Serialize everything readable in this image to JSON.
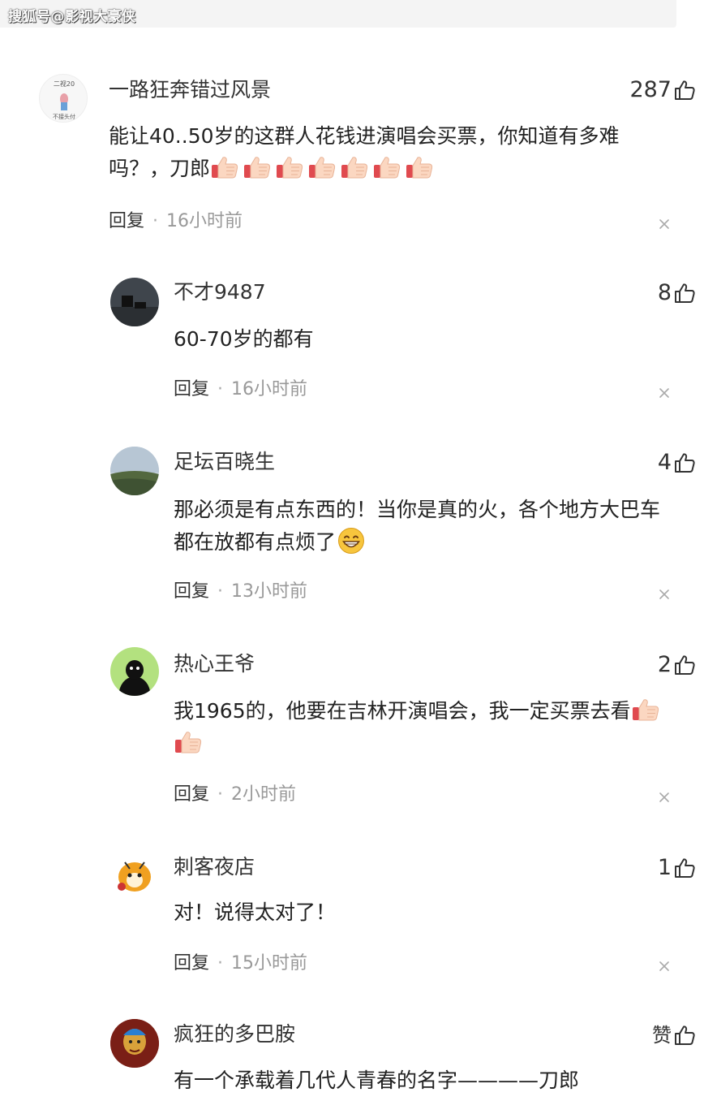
{
  "watermark": "搜狐号@影视大豪侠",
  "comments": [
    {
      "username": "一路狂奔错过风景",
      "likes": "287",
      "text": "能让40..50岁的这群人花钱进演唱会买票，你知道有多难吗？，刀郎",
      "emoji_count": 7,
      "reply_label": "回复",
      "separator": "·",
      "time": "16小时前",
      "avatar": {
        "text_top": "二视20",
        "text_bottom": "不接头付"
      }
    },
    {
      "username": "不才9487",
      "likes": "8",
      "text": "60-70岁的都有",
      "reply_label": "回复",
      "separator": "·",
      "time": "16小时前"
    },
    {
      "username": "足坛百晓生",
      "likes": "4",
      "text": "那必须是有点东西的！当你是真的火，各个地方大巴车都在放都有点烦了",
      "reply_label": "回复",
      "separator": "·",
      "time": "13小时前"
    },
    {
      "username": "热心王爷",
      "likes": "2",
      "text": "我1965的，他要在吉林开演唱会，我一定买票去看",
      "emoji_count": 2,
      "reply_label": "回复",
      "separator": "·",
      "time": "2小时前"
    },
    {
      "username": "刺客夜店",
      "likes": "1",
      "text": "对！说得太对了！",
      "reply_label": "回复",
      "separator": "·",
      "time": "15小时前"
    },
    {
      "username": "疯狂的多巴胺",
      "likes": "赞",
      "text": "有一个承载着几代人青春的名字————刀郎"
    }
  ],
  "colors": {
    "text": "#222222",
    "meta": "#999999",
    "username": "#333333",
    "watermark_bar": "#f4f4f4"
  },
  "icons": [
    "thumbs-up-icon",
    "close-icon",
    "thumbs-up-emoji",
    "grin-emoji"
  ]
}
